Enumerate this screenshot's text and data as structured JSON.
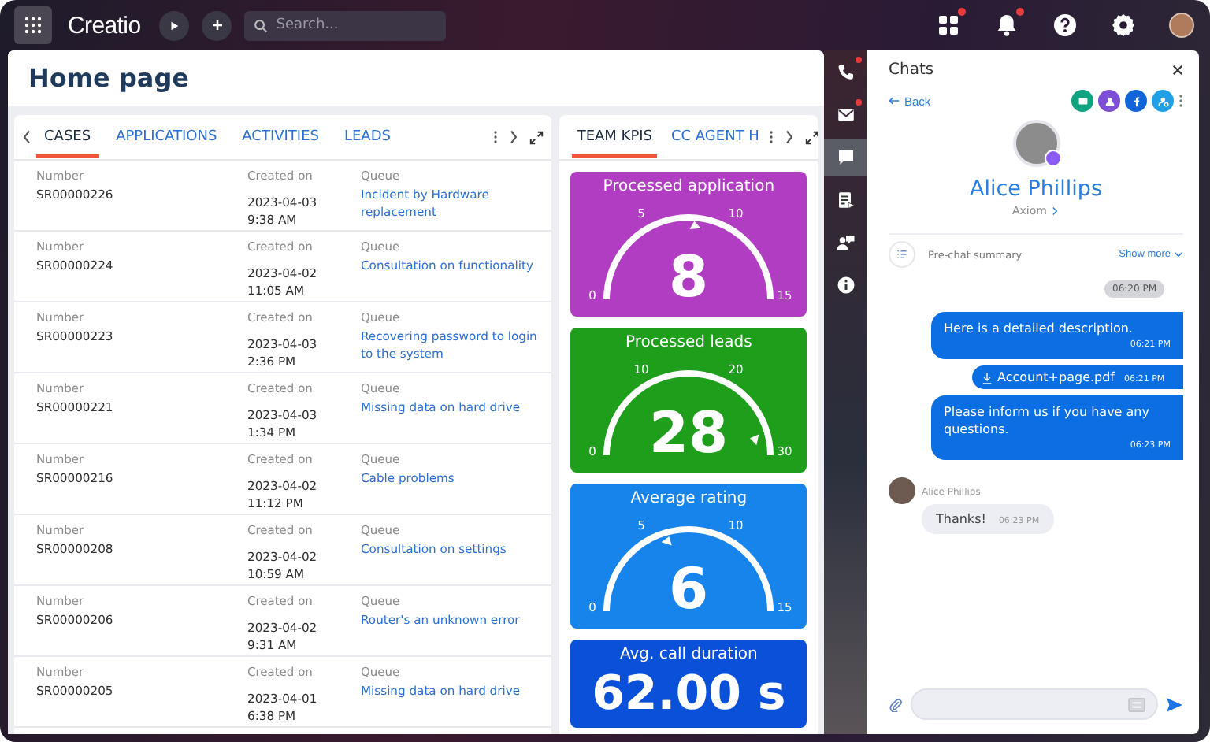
{
  "topbar": {
    "logo": "Creatio",
    "search": {
      "placeholder": "Search..."
    },
    "icons": [
      {
        "kind": "apps",
        "notification": true
      },
      {
        "kind": "bell",
        "notification": true
      },
      {
        "kind": "help",
        "notification": false
      },
      {
        "kind": "settings",
        "notification": false
      }
    ]
  },
  "page": {
    "title": "Home page"
  },
  "cases": {
    "tabs": [
      {
        "label": "CASES",
        "selected": true
      },
      {
        "label": "APPLICATIONS",
        "selected": false
      },
      {
        "label": "ACTIVITIES",
        "selected": false
      },
      {
        "label": "LEADS",
        "selected": false
      }
    ],
    "rows": [
      {
        "number_label": "Number",
        "number": "SR00000226",
        "created_label": "Created on",
        "date": "2023-04-03",
        "time": "9:38 AM",
        "queue_label": "Queue",
        "queue": "Incident by Hardware replacement"
      },
      {
        "number_label": "Number",
        "number": "SR00000224",
        "created_label": "Created on",
        "date": "2023-04-02",
        "time": "11:05 AM",
        "queue_label": "Queue",
        "queue": "Consultation on functionality"
      },
      {
        "number_label": "Number",
        "number": "SR00000223",
        "created_label": "Created on",
        "date": "2023-04-03",
        "time": "2:36 PM",
        "queue_label": "Queue",
        "queue": "Recovering password to login to the system"
      },
      {
        "number_label": "Number",
        "number": "SR00000221",
        "created_label": "Created on",
        "date": "2023-04-03",
        "time": "1:34 PM",
        "queue_label": "Queue",
        "queue": "Missing data on hard drive"
      },
      {
        "number_label": "Number",
        "number": "SR00000216",
        "created_label": "Created on",
        "date": "2023-04-02",
        "time": "11:12 PM",
        "queue_label": "Queue",
        "queue": "Cable problems"
      },
      {
        "number_label": "Number",
        "number": "SR00000208",
        "created_label": "Created on",
        "date": "2023-04-02",
        "time": "10:59 AM",
        "queue_label": "Queue",
        "queue": "Consultation on settings"
      },
      {
        "number_label": "Number",
        "number": "SR00000206",
        "created_label": "Created on",
        "date": "2023-04-02",
        "time": "9:31 AM",
        "queue_label": "Queue",
        "queue": "Router's an unknown error"
      },
      {
        "number_label": "Number",
        "number": "SR00000205",
        "created_label": "Created on",
        "date": "2023-04-01",
        "time": "6:38 PM",
        "queue_label": "Queue",
        "queue": "Missing data on hard drive"
      }
    ]
  },
  "kpis": {
    "tabs": [
      {
        "label": "TEAM KPIS",
        "selected": true
      },
      {
        "label": "CC AGENT H",
        "selected": false
      }
    ],
    "cards": [
      {
        "kind": "gauge",
        "title": "Processed application",
        "value": "8",
        "level": 0.53,
        "ticks": [
          "0",
          "5",
          "10",
          "15"
        ],
        "color": "#b13ec2"
      },
      {
        "kind": "gauge",
        "title": "Processed leads",
        "value": "28",
        "level": 0.93,
        "ticks": [
          "0",
          "10",
          "20",
          "30"
        ],
        "color": "#1f9e1c"
      },
      {
        "kind": "gauge",
        "title": "Average rating",
        "value": "6",
        "level": 0.4,
        "ticks": [
          "0",
          "5",
          "10",
          "15"
        ],
        "color": "#1784ec"
      },
      {
        "kind": "number",
        "title": "Avg. call duration",
        "value": "62.00 s",
        "color": "#0a50d8"
      }
    ]
  },
  "sidebar": {
    "items": [
      {
        "kind": "phone",
        "selected": false,
        "notification": true
      },
      {
        "kind": "mail",
        "selected": false,
        "notification": true
      },
      {
        "kind": "chat",
        "selected": true,
        "notification": false
      },
      {
        "kind": "form",
        "selected": false,
        "notification": false
      },
      {
        "kind": "people",
        "selected": false,
        "notification": false
      },
      {
        "kind": "info",
        "selected": false,
        "notification": false
      }
    ]
  },
  "chat": {
    "title": "Chats",
    "back": "Back",
    "contact": {
      "name": "Alice Phillips",
      "company": "Axiom"
    },
    "summary": {
      "label": "Pre-chat summary",
      "action": "Show more"
    },
    "messages": [
      {
        "kind": "time",
        "text": "06:20 PM"
      },
      {
        "kind": "out",
        "text": "Here is a detailed description.",
        "time": "06:21 PM"
      },
      {
        "kind": "file",
        "text": "Account+page.pdf",
        "time": "06:21 PM"
      },
      {
        "kind": "out",
        "text": "Please inform us if you have any questions.",
        "time": "06:23 PM"
      },
      {
        "kind": "in",
        "sender": "Alice Phillips",
        "text": "Thanks!",
        "time": "06:23 PM"
      }
    ]
  }
}
